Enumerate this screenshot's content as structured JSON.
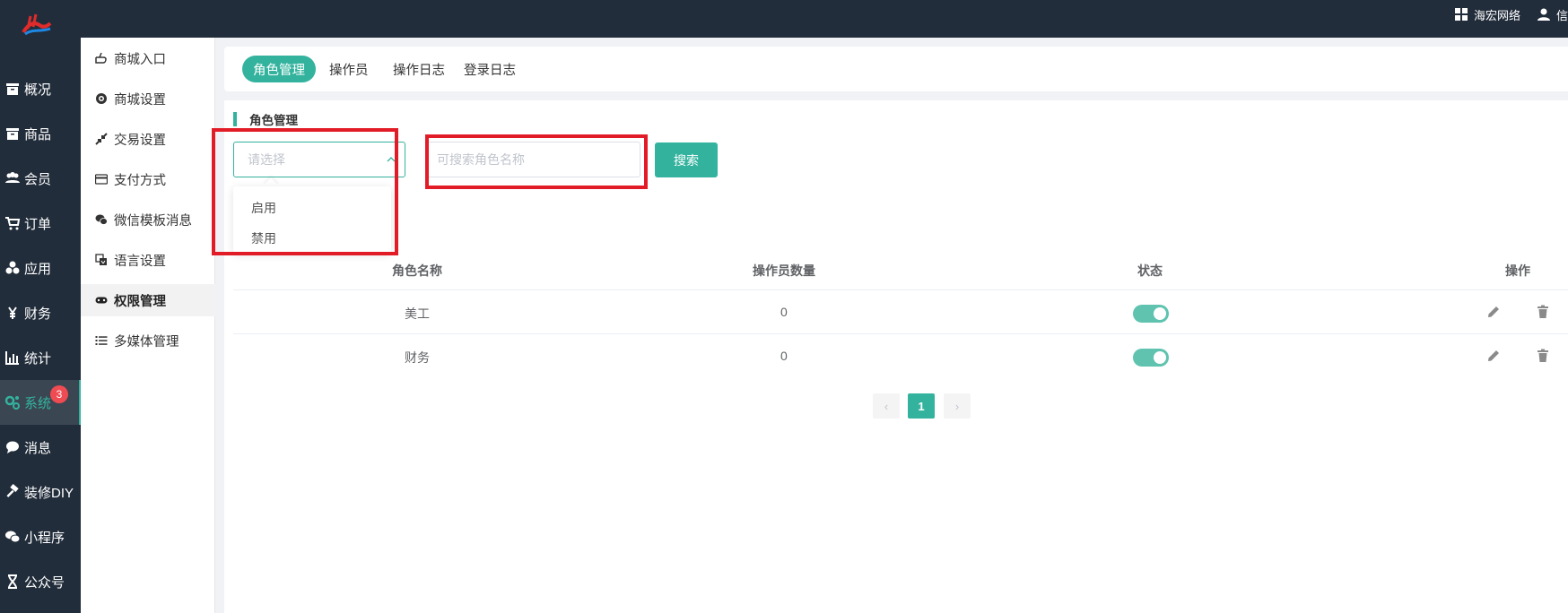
{
  "topbar": {
    "store_name": "海宏网络",
    "user_label": "信",
    "icons": {
      "store": "grid-icon",
      "user": "user-icon",
      "logo": "brand-logo"
    }
  },
  "nav": {
    "items": [
      {
        "label": "概况",
        "icon": "archive-icon",
        "active": false
      },
      {
        "label": "商品",
        "icon": "box-icon",
        "active": false
      },
      {
        "label": "会员",
        "icon": "users-icon",
        "active": false
      },
      {
        "label": "订单",
        "icon": "cart-icon",
        "active": false
      },
      {
        "label": "应用",
        "icon": "cubes-icon",
        "active": false
      },
      {
        "label": "财务",
        "icon": "yen-icon",
        "active": false
      },
      {
        "label": "统计",
        "icon": "bar-chart-icon",
        "active": false
      },
      {
        "label": "系统",
        "icon": "gears-icon",
        "active": true
      },
      {
        "label": "消息",
        "icon": "chat-icon",
        "active": false
      },
      {
        "label": "装修DIY",
        "icon": "hammer-icon",
        "active": false
      },
      {
        "label": "小程序",
        "icon": "wechat-icon",
        "active": false
      },
      {
        "label": "公众号",
        "icon": "hourglass-icon",
        "active": false
      }
    ],
    "message_badge": "3"
  },
  "subnav": {
    "items": [
      {
        "label": "商城入口",
        "icon": "hand-point-icon",
        "active": false
      },
      {
        "label": "商城设置",
        "icon": "gear-icon",
        "active": false
      },
      {
        "label": "交易设置",
        "icon": "compress-icon",
        "active": false
      },
      {
        "label": "支付方式",
        "icon": "credit-card-icon",
        "active": false
      },
      {
        "label": "微信模板消息",
        "icon": "wechat-icon",
        "active": false
      },
      {
        "label": "语言设置",
        "icon": "translate-icon",
        "active": false
      },
      {
        "label": "权限管理",
        "icon": "gamepad-icon",
        "active": true
      },
      {
        "label": "多媒体管理",
        "icon": "list-icon",
        "active": false
      }
    ]
  },
  "tabs": [
    {
      "label": "角色管理",
      "active": true
    },
    {
      "label": "操作员",
      "active": false
    },
    {
      "label": "操作日志",
      "active": false
    },
    {
      "label": "登录日志",
      "active": false
    }
  ],
  "filter": {
    "title": "角色管理",
    "status_placeholder": "请选择",
    "status_options": [
      "启用",
      "禁用"
    ],
    "search_placeholder": "可搜索角色名称",
    "search_button": "搜索"
  },
  "table": {
    "headers": [
      "角色名称",
      "操作员数量",
      "状态",
      "操作"
    ],
    "rows": [
      {
        "name": "美工",
        "operators": "0",
        "enabled": true
      },
      {
        "name": "财务",
        "operators": "0",
        "enabled": true
      }
    ]
  },
  "pagination": {
    "current": "1",
    "prev": "‹",
    "next": "›"
  },
  "colors": {
    "accent": "#33b39e",
    "sidebar": "#222d3b",
    "highlight": "#e21c26",
    "badge": "#ef4b52"
  }
}
